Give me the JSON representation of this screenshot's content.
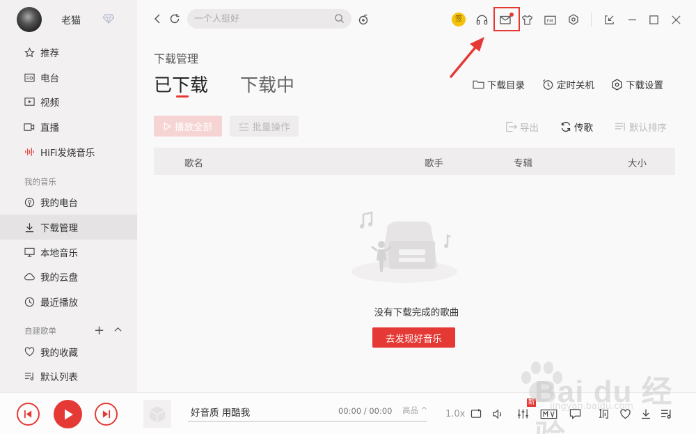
{
  "user": {
    "name": "老猫"
  },
  "sidebar": {
    "items": [
      {
        "label": "推荐",
        "icon": "star-icon"
      },
      {
        "label": "电台",
        "icon": "radio-icon"
      },
      {
        "label": "视频",
        "icon": "video-icon"
      },
      {
        "label": "直播",
        "icon": "live-icon"
      },
      {
        "label": "HiFi发烧音乐",
        "icon": "hifi-icon"
      }
    ],
    "section_mine": "我的音乐",
    "mine_items": [
      {
        "label": "我的电台",
        "icon": "my-radio-icon"
      },
      {
        "label": "下载管理",
        "icon": "download-icon",
        "active": true
      },
      {
        "label": "本地音乐",
        "icon": "monitor-icon"
      },
      {
        "label": "我的云盘",
        "icon": "cloud-icon"
      },
      {
        "label": "最近播放",
        "icon": "clock-icon"
      }
    ],
    "section_playlists": "自建歌单",
    "playlist_items": [
      {
        "label": "我的收藏",
        "icon": "heart-icon"
      },
      {
        "label": "默认列表",
        "icon": "list-icon"
      }
    ]
  },
  "topbar": {
    "search_placeholder": "一个人挺好",
    "sign_label": "签"
  },
  "main": {
    "page_title": "下载管理",
    "tab_downloaded": "已下载",
    "tab_downloading": "下载中",
    "action_dir": "下载目录",
    "action_timer": "定时关机",
    "action_settings": "下载设置",
    "btn_play_all": "播放全部",
    "btn_batch": "批量操作",
    "export": "导出",
    "transfer": "传歌",
    "sort": "默认排序",
    "columns": [
      "歌名",
      "歌手",
      "专辑",
      "大小"
    ],
    "empty_text": "没有下载完成的歌曲",
    "discover_button": "去发现好音乐"
  },
  "player": {
    "song": "好音质 用酷我",
    "time": "00:00 / 00:00",
    "quality": "高品 ^",
    "speed": "1.0x",
    "new_tag": "新",
    "progress": 0,
    "icons": [
      "prev-icon",
      "play-icon",
      "next-icon",
      "loop-icon",
      "volume-icon",
      "equalizer-icon",
      "mv-icon",
      "comment-icon",
      "lyrics-icon",
      "like-icon",
      "download-icon",
      "playlist-icon"
    ]
  },
  "watermark": {
    "brand": "Bai du 经验",
    "url": "jingyan.baidu.com"
  },
  "colors": {
    "accent": "#e53935",
    "sidebar_bg": "#f2f0f0",
    "main_bg": "#faf9f9"
  }
}
